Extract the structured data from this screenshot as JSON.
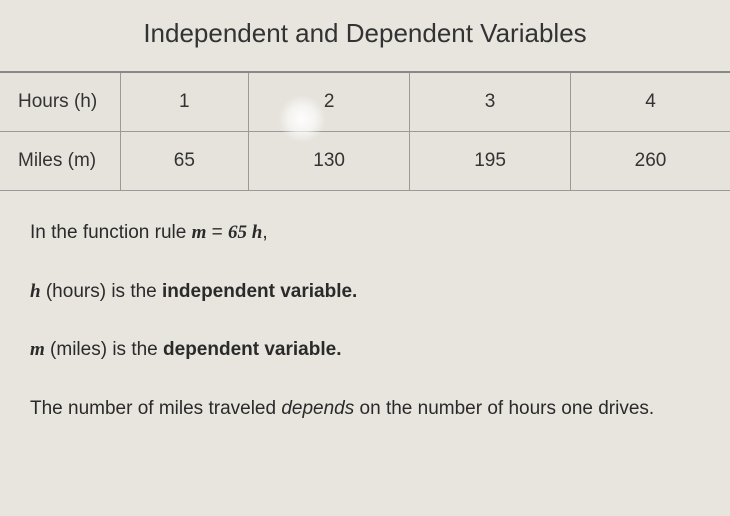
{
  "title": "Independent and Dependent Variables",
  "table": {
    "row1_header": "Hours (h)",
    "row2_header": "Miles (m)",
    "hours": {
      "c1": "1",
      "c2": "2",
      "c3": "3",
      "c4": "4"
    },
    "miles": {
      "c1": "65",
      "c2": "130",
      "c3": "195",
      "c4": "260"
    }
  },
  "text": {
    "line1_a": "In the function rule ",
    "line1_b": "m",
    "line1_c": " = ",
    "line1_d": "65 h",
    "line1_e": ",",
    "line2_a": "h",
    "line2_b": " (hours) is the ",
    "line2_c": "independent variable.",
    "line3_a": "m",
    "line3_b": " (miles) is the ",
    "line3_c": "dependent variable.",
    "line4_a": "The number of miles traveled ",
    "line4_b": "depends",
    "line4_c": " on the number of hours one drives."
  },
  "chart_data": {
    "type": "table",
    "title": "Independent and Dependent Variables",
    "columns": [
      "Hours (h)",
      "Miles (m)"
    ],
    "rows": [
      {
        "Hours (h)": 1,
        "Miles (m)": 65
      },
      {
        "Hours (h)": 2,
        "Miles (m)": 130
      },
      {
        "Hours (h)": 3,
        "Miles (m)": 195
      },
      {
        "Hours (h)": 4,
        "Miles (m)": 260
      }
    ],
    "function_rule": "m = 65h",
    "independent_variable": "h (hours)",
    "dependent_variable": "m (miles)"
  }
}
